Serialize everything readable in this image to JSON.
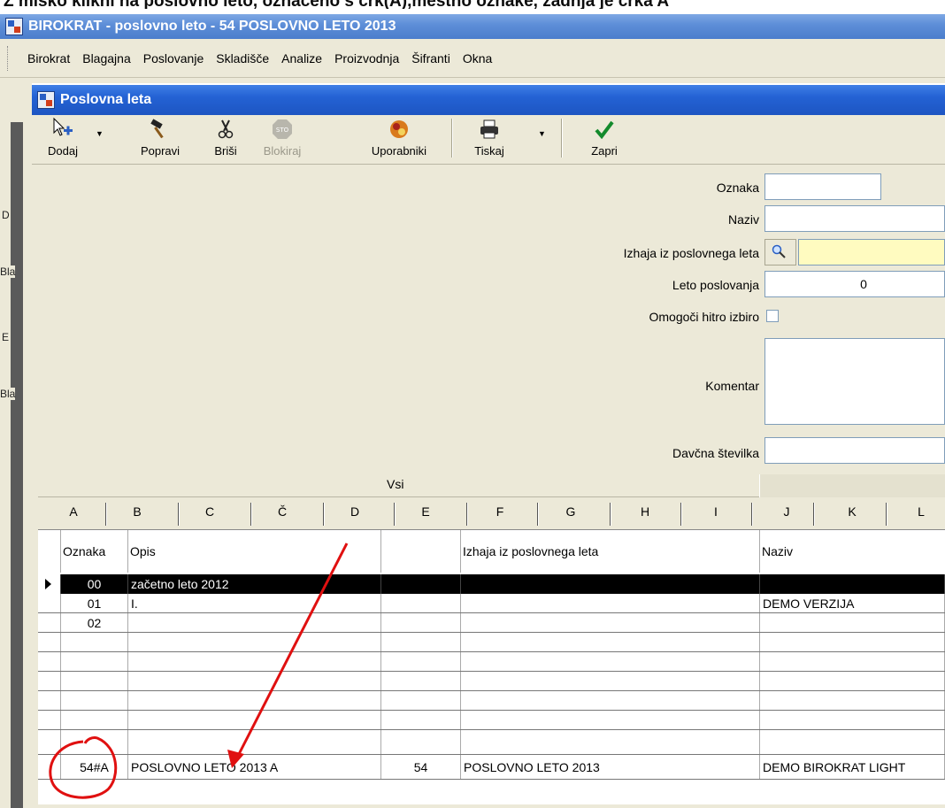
{
  "caption": "Z miško kliknl na poslovno leto, označeno s črk(A),mestno oznake, zadnja je črka A",
  "app": {
    "title": "BIROKRAT - poslovno leto - 54 POSLOVNO LETO 2013",
    "accent": "#2462d4"
  },
  "menu": [
    "Birokrat",
    "Blagajna",
    "Poslovanje",
    "Skladišče",
    "Analize",
    "Proizvodnja",
    "Šifranti",
    "Okna"
  ],
  "sidebar": {
    "labels": [
      "D",
      "Bla",
      "E",
      "Bla"
    ]
  },
  "window": {
    "title": "Poslovna leta"
  },
  "toolbar": {
    "dodaj": "Dodaj",
    "popravi": "Popravi",
    "brisi": "Briši",
    "blokiraj": "Blokiraj",
    "uporabniki": "Uporabniki",
    "tiskaj": "Tiskaj",
    "zapri": "Zapri",
    "stop_text": "STO"
  },
  "form": {
    "oznaka_label": "Oznaka",
    "naziv_label": "Naziv",
    "izhaja_label": "Izhaja iz poslovnega leta",
    "leto_label": "Leto poslovanja",
    "leto_value": "0",
    "hitro_label": "Omogoči hitro izbiro",
    "komentar_label": "Komentar",
    "davcna_label": "Davčna številka"
  },
  "grid": {
    "group_label": "Vsi",
    "columns": [
      "A",
      "B",
      "C",
      "Č",
      "D",
      "E",
      "F",
      "G",
      "H",
      "I",
      "J",
      "K",
      "L"
    ],
    "headers": {
      "oznaka": "Oznaka",
      "opis": "Opis",
      "izhaja": "Izhaja iz poslovnega leta",
      "naziv": "Naziv"
    },
    "rows": [
      {
        "oznaka": "00",
        "opis": "začetno leto 2012",
        "e": "",
        "izhaja": "",
        "naziv": "",
        "selected": true
      },
      {
        "oznaka": "01",
        "opis": "I.",
        "e": "",
        "izhaja": "",
        "naziv": "DEMO VERZIJA"
      },
      {
        "oznaka": "02",
        "opis": "",
        "e": "",
        "izhaja": "",
        "naziv": ""
      },
      {
        "oznaka": "",
        "opis": "",
        "e": "",
        "izhaja": "",
        "naziv": ""
      },
      {
        "oznaka": "",
        "opis": "",
        "e": "",
        "izhaja": "",
        "naziv": ""
      },
      {
        "oznaka": "",
        "opis": "",
        "e": "",
        "izhaja": "",
        "naziv": ""
      },
      {
        "oznaka": "",
        "opis": "",
        "e": "",
        "izhaja": "",
        "naziv": ""
      },
      {
        "oznaka": "",
        "opis": "",
        "e": "",
        "izhaja": "",
        "naziv": ""
      },
      {
        "oznaka": "",
        "opis": "",
        "e": "",
        "izhaja": "",
        "naziv": ""
      },
      {
        "oznaka": "54#A",
        "opis": "POSLOVNO LETO 2013 A",
        "e": "54",
        "izhaja": "POSLOVNO LETO 2013",
        "naziv": "DEMO BIROKRAT LIGHT"
      }
    ]
  },
  "annotation": {
    "color": "#e01010"
  }
}
